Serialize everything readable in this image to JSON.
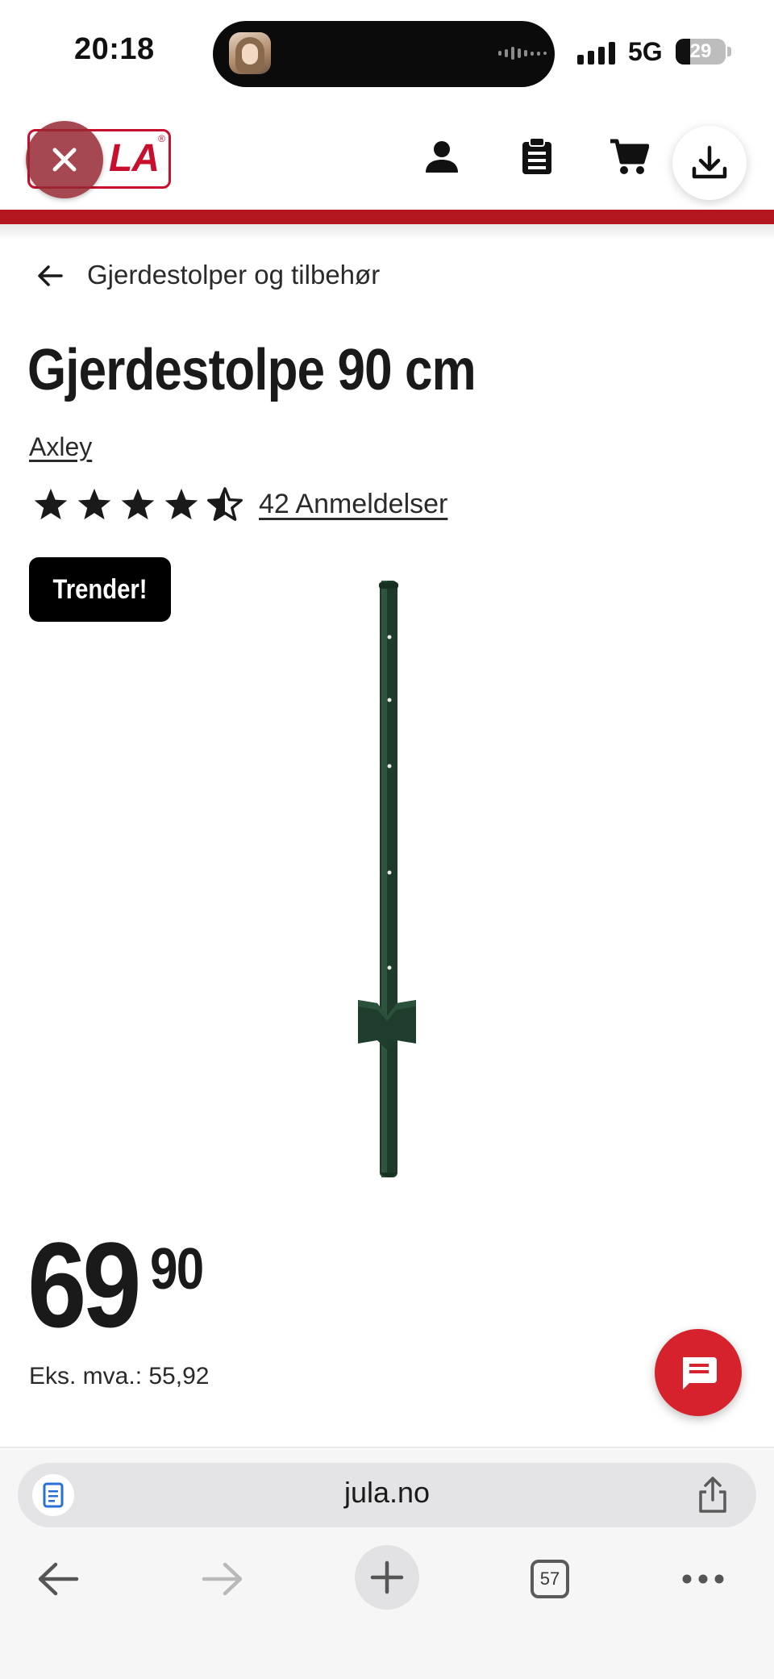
{
  "status_bar": {
    "time": "20:18",
    "network": "5G",
    "battery": "29"
  },
  "header": {
    "logo_text": "LA",
    "logo_reg": "®",
    "icons": [
      "close-icon",
      "account-icon",
      "shopping-list-icon",
      "cart-icon",
      "download-icon"
    ]
  },
  "breadcrumb": {
    "label": "Gjerdestolper og tilbehør"
  },
  "product": {
    "title": "Gjerdestolpe 90 cm",
    "brand": "Axley",
    "rating": 4.5,
    "rating_max": 5,
    "reviews_label": "42 Anmeldelser",
    "badge": "Trender!",
    "price_integer": "69",
    "price_decimal": "90",
    "vat_label": "Eks. mva.: 55,92",
    "image_desc": "green-steel-fence-post",
    "post_color": "#1f3d2c"
  },
  "browser": {
    "url": "jula.no",
    "tabs_count": "57"
  },
  "colors": {
    "brand_red": "#b3161e",
    "chat_red": "#d6222c"
  }
}
